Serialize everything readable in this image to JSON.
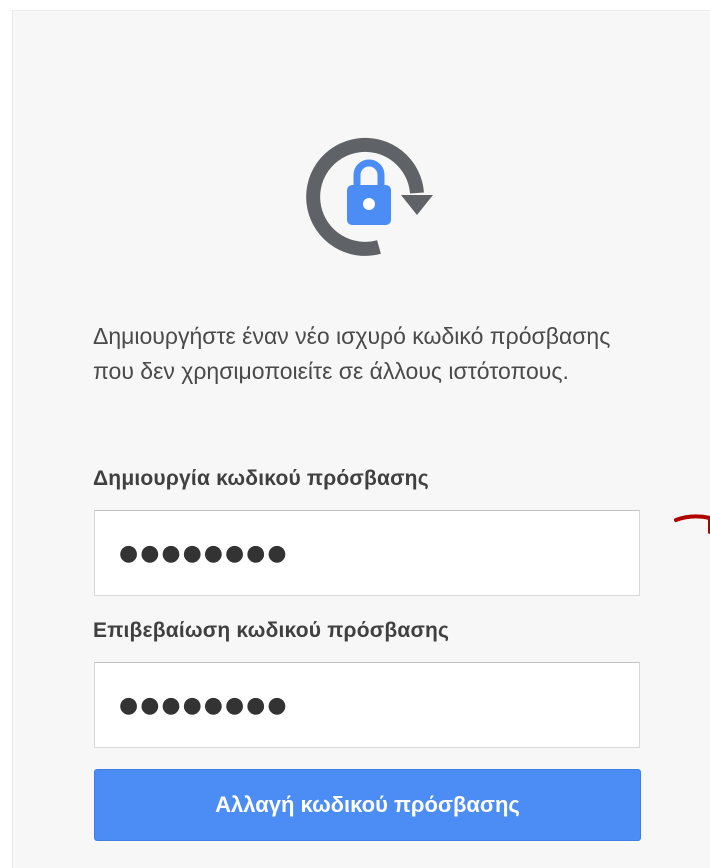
{
  "header": {
    "logo_icon": "lock-refresh-icon",
    "colors": {
      "ring": "#5f6368",
      "lock": "#4c8df5"
    }
  },
  "form": {
    "intro": "Δημιουργήστε έναν νέο ισχυρό κωδικό πρόσβασης που δεν χρησιμοποιείτε σε άλλους ιστότοπους.",
    "new_password_label": "Δημιουργία κωδικού πρόσβασης",
    "new_password_value": "●●●●●●●●",
    "confirm_password_label": "Επιβεβαίωση κωδικού πρόσβασης",
    "confirm_password_value": "●●●●●●●●",
    "submit_label": "Αλλαγή κωδικού πρόσβασης",
    "button_color": "#4c8df5"
  }
}
